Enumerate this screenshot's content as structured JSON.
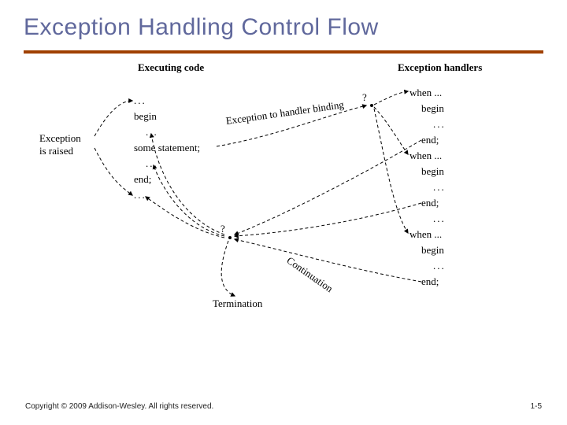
{
  "slide": {
    "title": "Exception Handling Control Flow",
    "column_left": "Executing code",
    "column_right": "Exception handlers",
    "raised_label": "Exception\nis raised",
    "code": {
      "l1": "...",
      "l2": "begin",
      "l3": "...",
      "l4": "some  statement;",
      "l5": "...",
      "l6": "end;",
      "l7": "..."
    },
    "handlers": [
      {
        "when": "when ...",
        "begin": "begin",
        "body": "...",
        "end": "end;"
      },
      {
        "when": "when ...",
        "begin": "begin",
        "body": "...",
        "end": "end;",
        "sep": "..."
      },
      {
        "when": "when ...",
        "begin": "begin",
        "body": "...",
        "end": "end;"
      }
    ],
    "labels": {
      "binding": "Exception to handler binding",
      "binding_q": "?",
      "continuation": "Continuation",
      "termination": "Termination",
      "q2": "?"
    }
  },
  "footer": {
    "copyright": "Copyright © 2009 Addison-Wesley. All rights reserved.",
    "pageno": "1-5"
  }
}
